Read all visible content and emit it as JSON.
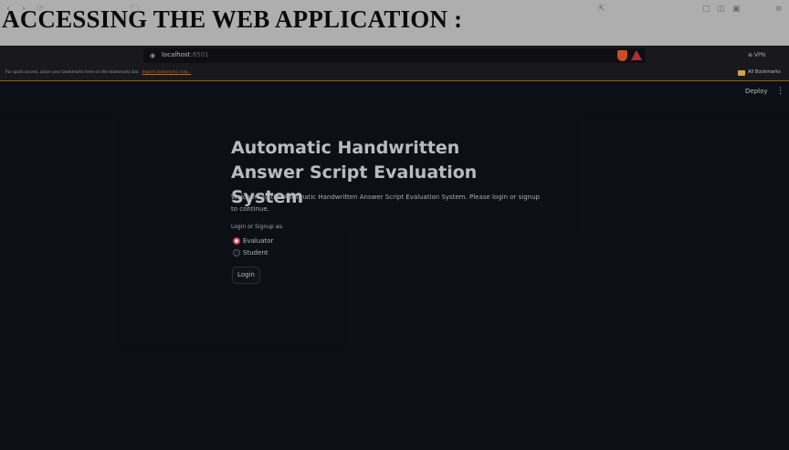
{
  "document": {
    "heading": "ACCESSING THE WEB APPLICATION :"
  },
  "browser": {
    "nav_icons": {
      "back": "‹",
      "forward": "›",
      "reload": "⟳",
      "bookmark": "⬚",
      "site_info": "◉"
    },
    "url": {
      "host": "localhost",
      "port": ":8501"
    },
    "right_icons": {
      "share": "⇱",
      "extensions": "▢",
      "sidebar": "◫",
      "wallet": "▣",
      "menu": "≡"
    },
    "vpn_label": "⊕ VPN",
    "bookmarks_bar": {
      "hint": "For quick access, place your bookmarks here on the bookmarks bar.",
      "import_link": "Import bookmarks now...",
      "all_bookmarks": "All Bookmarks"
    }
  },
  "app": {
    "deploy_label": "Deploy",
    "menu_icon": "⋮",
    "title": "Automatic Handwritten Answer Script Evaluation System",
    "welcome": "Welcome to the Automatic Handwritten Answer Script Evaluation System. Please login or signup to continue.",
    "role_label": "Login or Signup as:",
    "roles": [
      {
        "label": "Evaluator",
        "selected": true
      },
      {
        "label": "Student",
        "selected": false
      }
    ],
    "login_button": "Login"
  },
  "colors": {
    "app_background": "#0e1117",
    "browser_chrome": "#1c1c20",
    "radio_selected": "#e04550",
    "link": "#c2762f"
  }
}
